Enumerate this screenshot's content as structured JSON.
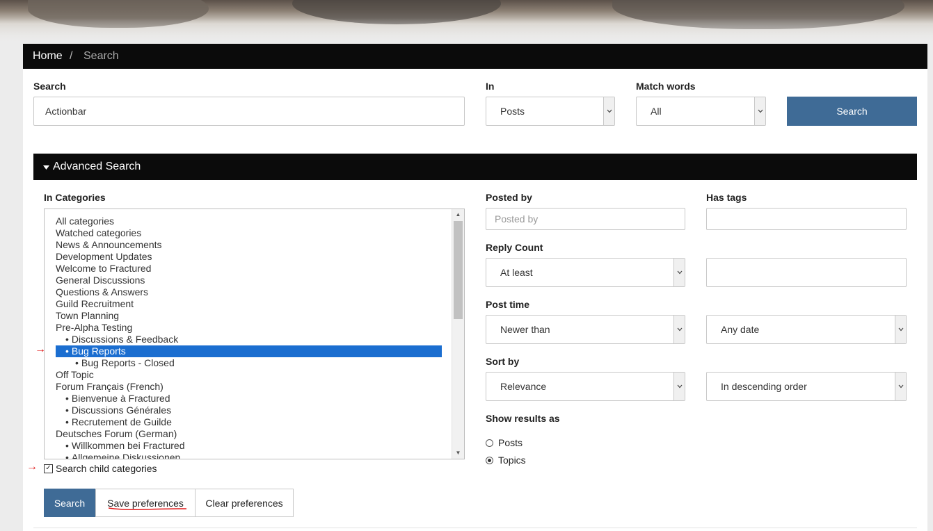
{
  "breadcrumb": {
    "home": "Home",
    "separator": "/",
    "current": "Search"
  },
  "search": {
    "label": "Search",
    "value": "Actionbar",
    "in_label": "In",
    "in_value": "Posts",
    "match_label": "Match words",
    "match_value": "All",
    "button": "Search"
  },
  "advanced": {
    "toggle_label": "Advanced Search",
    "categories_label": "In Categories",
    "categories": [
      {
        "label": "All categories",
        "level": 0
      },
      {
        "label": "Watched categories",
        "level": 0
      },
      {
        "label": "News & Announcements",
        "level": 0
      },
      {
        "label": "Development Updates",
        "level": 0
      },
      {
        "label": "Welcome to Fractured",
        "level": 0
      },
      {
        "label": "General Discussions",
        "level": 0
      },
      {
        "label": "Questions & Answers",
        "level": 0
      },
      {
        "label": "Guild Recruitment",
        "level": 0
      },
      {
        "label": "Town Planning",
        "level": 0
      },
      {
        "label": "Pre-Alpha Testing",
        "level": 0
      },
      {
        "label": "Discussions & Feedback",
        "level": 1
      },
      {
        "label": "Bug Reports",
        "level": 1,
        "selected": true
      },
      {
        "label": "Bug Reports - Closed",
        "level": 2
      },
      {
        "label": "Off Topic",
        "level": 0
      },
      {
        "label": "Forum Français (French)",
        "level": 0
      },
      {
        "label": "Bienvenue à Fractured",
        "level": 1
      },
      {
        "label": "Discussions Générales",
        "level": 1
      },
      {
        "label": "Recrutement de Guilde",
        "level": 1
      },
      {
        "label": "Deutsches Forum (German)",
        "level": 0
      },
      {
        "label": "Willkommen bei Fractured",
        "level": 1
      },
      {
        "label": "Allgemeine Diskussionen",
        "level": 1
      }
    ],
    "bullet": "•",
    "search_child_label": "Search child categories",
    "search_child_checked": true,
    "posted_by_label": "Posted by",
    "posted_by_placeholder": "Posted by",
    "has_tags_label": "Has tags",
    "reply_count_label": "Reply Count",
    "reply_count_mode": "At least",
    "post_time_label": "Post time",
    "post_time_mode": "Newer than",
    "post_time_value": "Any date",
    "sort_by_label": "Sort by",
    "sort_by_value": "Relevance",
    "sort_order_value": "In descending order",
    "show_results_label": "Show results as",
    "results_options": [
      "Posts",
      "Topics"
    ],
    "results_selected": "Topics"
  },
  "actions": {
    "search": "Search",
    "save_preferences": "Save preferences",
    "clear_preferences": "Clear preferences"
  },
  "annotation_color": "#e01b1b",
  "colors": {
    "primary": "#3f6b96",
    "bar": "#0b0b0b",
    "selection": "#1b6ed0"
  }
}
